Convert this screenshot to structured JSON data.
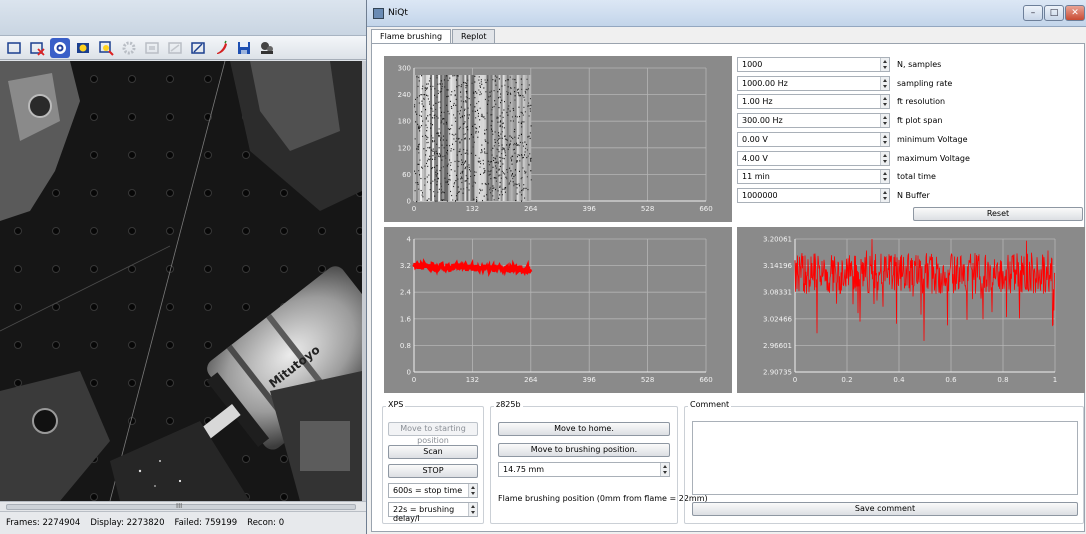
{
  "camera": {
    "status": {
      "frames": "Frames: 2274904",
      "display": "Display: 2273820",
      "failed": "Failed: 759199",
      "recon": "Recon: 0"
    },
    "scroll_grip": "III",
    "lens_label": "Mitutoyo",
    "toolbar_icons": [
      "rect-select-icon",
      "rect-delete-icon",
      "auto-settings-icon",
      "contrast-icon",
      "zoom-fit-icon",
      "disabled-gear-icon",
      "disabled-frame-icon",
      "disabled-frame2-icon",
      "draw-line-icon",
      "pepper-icon",
      "save-icon",
      "film-reel-icon"
    ]
  },
  "window": {
    "title": "NiQt",
    "min_label": "–",
    "max_label": "□",
    "close_label": "✕"
  },
  "tabs": [
    {
      "label": "Flame brushing",
      "active": true
    },
    {
      "label": "Replot",
      "active": false
    }
  ],
  "plots": {
    "spectrogram": {
      "x_ticks": [
        "0",
        "132",
        "264",
        "396",
        "528",
        "660"
      ],
      "y_ticks": [
        "0",
        "60",
        "120",
        "180",
        "240",
        "300"
      ]
    },
    "voltage_trace": {
      "x_ticks": [
        "0",
        "132",
        "264",
        "396",
        "528",
        "660"
      ],
      "y_ticks": [
        "0",
        "0.8",
        "1.6",
        "2.4",
        "3.2",
        "4"
      ],
      "trace_color": "#ff0000"
    },
    "zoom_trace": {
      "x_ticks": [
        "0",
        "0.2",
        "0.4",
        "0.6",
        "0.8",
        "1"
      ],
      "y_ticks": [
        "2.90735",
        "2.96601",
        "3.02466",
        "3.08331",
        "3.14196",
        "3.20061"
      ],
      "trace_color": "#ff0000"
    }
  },
  "settings": [
    {
      "value": "1000",
      "label": "N, samples"
    },
    {
      "value": "1000.00 Hz",
      "label": "sampling rate"
    },
    {
      "value": "1.00 Hz",
      "label": "ft resolution"
    },
    {
      "value": "300.00 Hz",
      "label": "ft plot span"
    },
    {
      "value": "0.00 V",
      "label": "minimum Voltage"
    },
    {
      "value": "4.00 V",
      "label": "maximum Voltage"
    },
    {
      "value": "11 min",
      "label": "total time"
    },
    {
      "value": "1000000",
      "label": "N Buffer"
    }
  ],
  "reset_label": "Reset",
  "xps": {
    "title": "XPS",
    "move_start_label": "Move to starting position",
    "scan_label": "Scan",
    "stop_label": "STOP",
    "stop_time": "600s = stop time",
    "brushing_delay": "22s = brushing delay/l"
  },
  "z825b": {
    "title": "z825b",
    "move_home_label": "Move to home.",
    "move_brushing_label": "Move to brushing position.",
    "position_value": "14.75 mm",
    "note": "Flame brushing position (0mm from flame = 22mm)"
  },
  "comment": {
    "title": "Comment",
    "value": "",
    "save_label": "Save comment"
  }
}
